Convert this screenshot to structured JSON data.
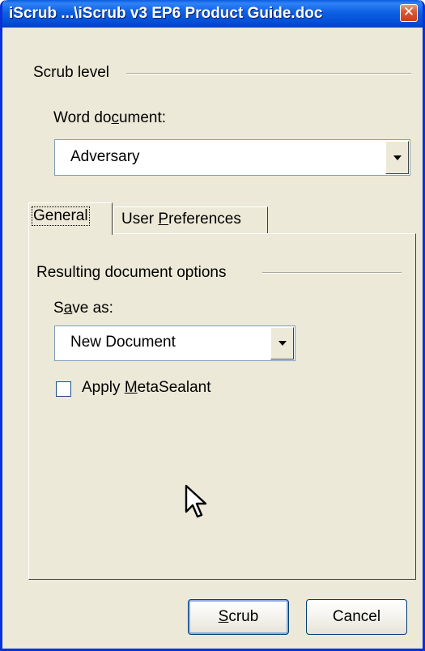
{
  "window": {
    "title": "iScrub ...\\iScrub v3 EP6 Product Guide.doc",
    "close_glyph": "✕",
    "accent_color": "#0831d9",
    "face_color": "#ece9d8"
  },
  "scrub_level": {
    "group_label": "Scrub level",
    "field_label_pre": "Word do",
    "field_label_accel": "c",
    "field_label_post": "ument:",
    "selected_value": "Adversary"
  },
  "tabs": [
    {
      "label": "General",
      "selected": true
    },
    {
      "label_pre": "User ",
      "label_accel": "P",
      "label_post": "references",
      "selected": false
    }
  ],
  "options": {
    "group_label": "Resulting document options",
    "save_as_label_pre": "S",
    "save_as_label_accel": "a",
    "save_as_label_post": "ve as:",
    "save_as_value": "New Document",
    "checkbox_label_pre": "Apply ",
    "checkbox_label_accel": "M",
    "checkbox_label_post": "etaSealant",
    "checkbox_checked": false
  },
  "buttons": {
    "scrub_accel": "S",
    "scrub_post": "crub",
    "cancel": "Cancel"
  },
  "icons": {
    "close": "close-icon",
    "dropdown": "chevron-down-icon",
    "cursor": "mouse-pointer-icon"
  }
}
